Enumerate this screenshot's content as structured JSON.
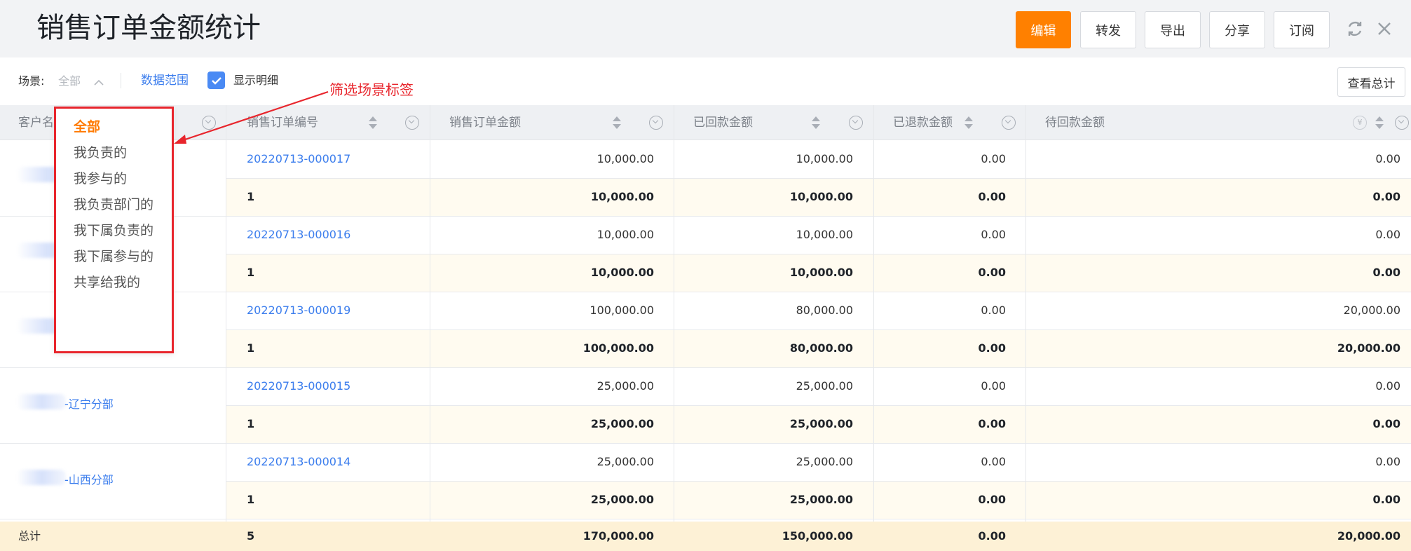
{
  "header": {
    "title": "销售订单金额统计",
    "buttons": {
      "edit": "编辑",
      "forward": "转发",
      "export": "导出",
      "share": "分享",
      "subscribe": "订阅"
    },
    "accent": "#ff8000"
  },
  "toolbar": {
    "scene_label": "场景:",
    "scene_value": "全部",
    "data_range": "数据范围",
    "show_detail": "显示明细",
    "show_detail_checked": true,
    "view_total": "查看总计"
  },
  "annotation": {
    "text": "筛选场景标签",
    "color": "#e8252c"
  },
  "scene_dropdown": {
    "items": [
      "全部",
      "我负责的",
      "我参与的",
      "我负责部门的",
      "我下属负责的",
      "我下属参与的",
      "共享给我的"
    ],
    "selected": "全部"
  },
  "table": {
    "columns": [
      "客户名称",
      "销售订单编号",
      "销售订单金额",
      "已回款金额",
      "已退款金额",
      "待回款金额"
    ],
    "groups": [
      {
        "customer": "",
        "order_no": "20220713-000017",
        "amount": "10,000.00",
        "received": "10,000.00",
        "refunded": "0.00",
        "pending": "0.00",
        "sub": {
          "count": "1",
          "amount": "10,000.00",
          "received": "10,000.00",
          "refunded": "0.00",
          "pending": "0.00"
        }
      },
      {
        "customer": "",
        "order_no": "20220713-000016",
        "amount": "10,000.00",
        "received": "10,000.00",
        "refunded": "0.00",
        "pending": "0.00",
        "sub": {
          "count": "1",
          "amount": "10,000.00",
          "received": "10,000.00",
          "refunded": "0.00",
          "pending": "0.00"
        }
      },
      {
        "customer": "",
        "order_no": "20220713-000019",
        "amount": "100,000.00",
        "received": "80,000.00",
        "refunded": "0.00",
        "pending": "20,000.00",
        "sub": {
          "count": "1",
          "amount": "100,000.00",
          "received": "80,000.00",
          "refunded": "0.00",
          "pending": "20,000.00"
        }
      },
      {
        "customer": "-辽宁分部",
        "order_no": "20220713-000015",
        "amount": "25,000.00",
        "received": "25,000.00",
        "refunded": "0.00",
        "pending": "0.00",
        "sub": {
          "count": "1",
          "amount": "25,000.00",
          "received": "25,000.00",
          "refunded": "0.00",
          "pending": "0.00"
        }
      },
      {
        "customer": "-山西分部",
        "order_no": "20220713-000014",
        "amount": "25,000.00",
        "received": "25,000.00",
        "refunded": "0.00",
        "pending": "0.00",
        "sub": {
          "count": "1",
          "amount": "25,000.00",
          "received": "25,000.00",
          "refunded": "0.00",
          "pending": "0.00"
        }
      }
    ],
    "footer": {
      "label": "总计",
      "count": "5",
      "amount": "170,000.00",
      "received": "150,000.00",
      "refunded": "0.00",
      "pending": "20,000.00"
    }
  }
}
